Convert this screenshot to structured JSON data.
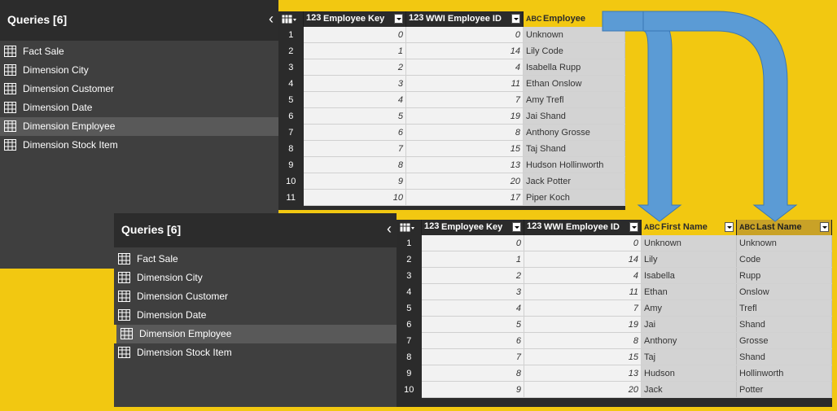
{
  "top": {
    "queries_title": "Queries [6]",
    "queries": [
      {
        "label": "Fact Sale",
        "selected": false
      },
      {
        "label": "Dimension City",
        "selected": false
      },
      {
        "label": "Dimension Customer",
        "selected": false
      },
      {
        "label": "Dimension Date",
        "selected": false
      },
      {
        "label": "Dimension Employee",
        "selected": true
      },
      {
        "label": "Dimension Stock Item",
        "selected": false
      }
    ],
    "columns": [
      "Employee Key",
      "WWI Employee ID",
      "Employee"
    ],
    "rows": [
      {
        "n": "1",
        "key": "0",
        "wwi": "0",
        "employee": "Unknown"
      },
      {
        "n": "2",
        "key": "1",
        "wwi": "14",
        "employee": "Lily Code"
      },
      {
        "n": "3",
        "key": "2",
        "wwi": "4",
        "employee": "Isabella Rupp"
      },
      {
        "n": "4",
        "key": "3",
        "wwi": "11",
        "employee": "Ethan Onslow"
      },
      {
        "n": "5",
        "key": "4",
        "wwi": "7",
        "employee": "Amy Trefl"
      },
      {
        "n": "6",
        "key": "5",
        "wwi": "19",
        "employee": "Jai Shand"
      },
      {
        "n": "7",
        "key": "6",
        "wwi": "8",
        "employee": "Anthony Grosse"
      },
      {
        "n": "8",
        "key": "7",
        "wwi": "15",
        "employee": "Taj Shand"
      },
      {
        "n": "9",
        "key": "8",
        "wwi": "13",
        "employee": "Hudson Hollinworth"
      },
      {
        "n": "10",
        "key": "9",
        "wwi": "20",
        "employee": "Jack Potter"
      },
      {
        "n": "11",
        "key": "10",
        "wwi": "17",
        "employee": "Piper Koch"
      }
    ]
  },
  "bottom": {
    "queries_title": "Queries [6]",
    "queries": [
      {
        "label": "Fact Sale",
        "selected": false
      },
      {
        "label": "Dimension City",
        "selected": false
      },
      {
        "label": "Dimension Customer",
        "selected": false
      },
      {
        "label": "Dimension Date",
        "selected": false
      },
      {
        "label": "Dimension Employee",
        "selected": true
      },
      {
        "label": "Dimension Stock Item",
        "selected": false
      }
    ],
    "columns": [
      "Employee Key",
      "WWI Employee ID",
      "First Name",
      "Last Name"
    ],
    "rows": [
      {
        "n": "1",
        "key": "0",
        "wwi": "0",
        "first": "Unknown",
        "last": "Unknown"
      },
      {
        "n": "2",
        "key": "1",
        "wwi": "14",
        "first": "Lily",
        "last": "Code"
      },
      {
        "n": "3",
        "key": "2",
        "wwi": "4",
        "first": "Isabella",
        "last": "Rupp"
      },
      {
        "n": "4",
        "key": "3",
        "wwi": "11",
        "first": "Ethan",
        "last": "Onslow"
      },
      {
        "n": "5",
        "key": "4",
        "wwi": "7",
        "first": "Amy",
        "last": "Trefl"
      },
      {
        "n": "6",
        "key": "5",
        "wwi": "19",
        "first": "Jai",
        "last": "Shand"
      },
      {
        "n": "7",
        "key": "6",
        "wwi": "8",
        "first": "Anthony",
        "last": "Grosse"
      },
      {
        "n": "8",
        "key": "7",
        "wwi": "15",
        "first": "Taj",
        "last": "Shand"
      },
      {
        "n": "9",
        "key": "8",
        "wwi": "13",
        "first": "Hudson",
        "last": "Hollinworth"
      },
      {
        "n": "10",
        "key": "9",
        "wwi": "20",
        "first": "Jack",
        "last": "Potter"
      }
    ]
  },
  "icons": {
    "collapse": "chevron-left-icon",
    "query": "table-icon",
    "number_type": "number-type-icon",
    "text_type": "text-type-icon",
    "filter": "dropdown-filter-icon",
    "split_arrow": "split-arrow-icon"
  },
  "type_labels": {
    "number": "123",
    "text": "ABC"
  },
  "colors": {
    "accent": "#f2c811",
    "arrow": "#5b9bd5",
    "panel": "#3f3f3f",
    "header": "#2c2c2c"
  }
}
